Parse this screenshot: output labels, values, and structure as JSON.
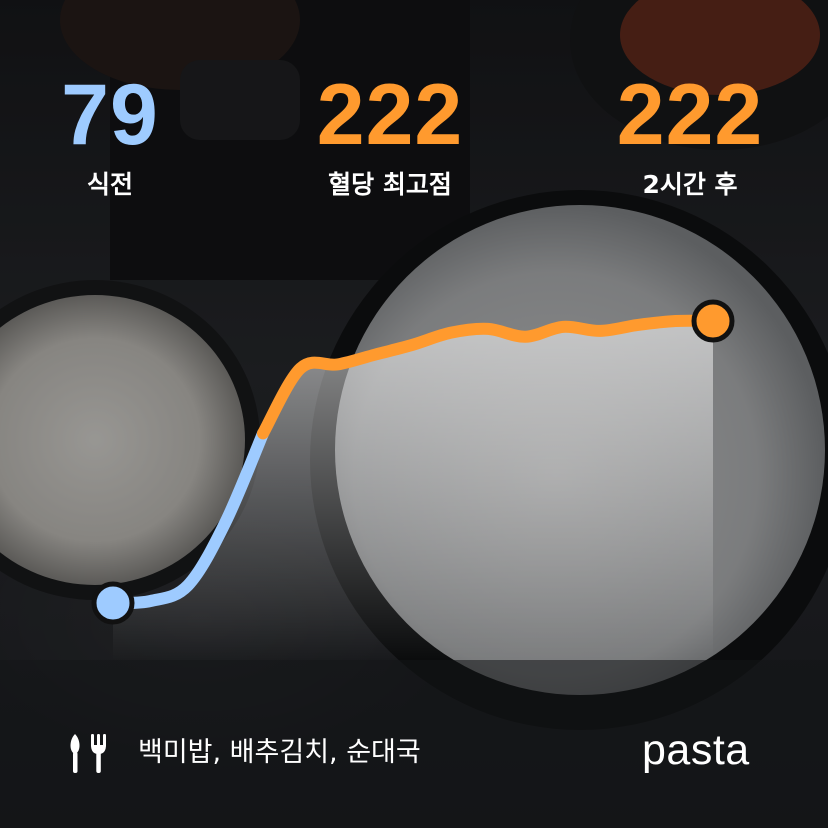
{
  "stats": {
    "before": {
      "value": "79",
      "label": "식전",
      "color": "#9ecbff"
    },
    "peak": {
      "value": "222",
      "label": "혈당 최고점",
      "color": "#ff9a2e"
    },
    "after": {
      "value": "222",
      "label": "2시간 후",
      "color": "#ff9a2e"
    }
  },
  "chart_data": {
    "type": "line",
    "title": "",
    "xlabel": "",
    "ylabel": "",
    "series": [
      {
        "y": [
          79,
          80,
          88,
          120,
          165,
          198,
          200,
          205,
          210,
          216,
          218,
          214,
          219,
          217,
          220,
          222,
          222
        ]
      }
    ],
    "start_value": 79,
    "end_value": 222,
    "colors": {
      "low": "#9ecbff",
      "high": "#ff9a2e"
    }
  },
  "footer": {
    "icon": "fork-knife-icon",
    "foods": "백미밥, 배추김치, 순대국",
    "brand": "pasta"
  }
}
